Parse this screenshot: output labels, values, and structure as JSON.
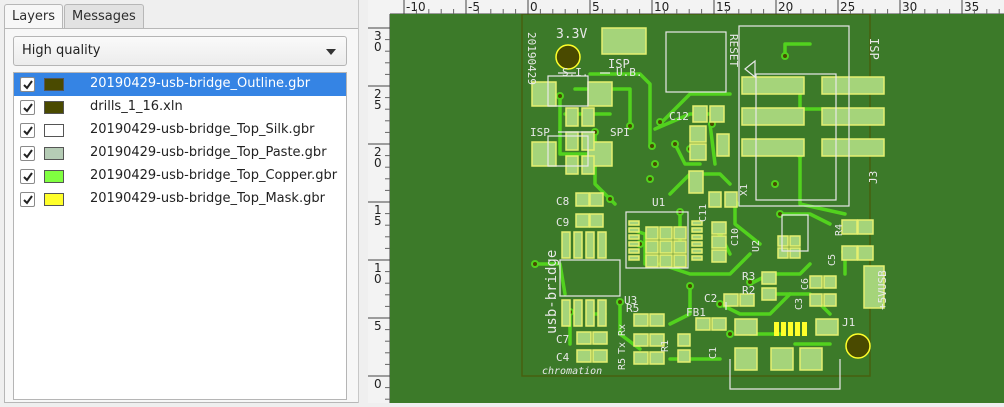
{
  "tabs": [
    {
      "label": "Layers",
      "active": true
    },
    {
      "label": "Messages",
      "active": false
    }
  ],
  "quality_select": {
    "value": "High quality"
  },
  "layers": [
    {
      "name": "20190429-usb-bridge_Outline.gbr",
      "visible": true,
      "color": "#4a4a00",
      "selected": true
    },
    {
      "name": "drills_1_16.xln",
      "visible": true,
      "color": "#4a4a00",
      "selected": false
    },
    {
      "name": "20190429-usb-bridge_Top_Silk.gbr",
      "visible": true,
      "color": "#ffffff",
      "selected": false
    },
    {
      "name": "20190429-usb-bridge_Top_Paste.gbr",
      "visible": true,
      "color": "#b5ccb5",
      "selected": false
    },
    {
      "name": "20190429-usb-bridge_Top_Copper.gbr",
      "visible": true,
      "color": "#80ff40",
      "selected": false
    },
    {
      "name": "20190429-usb-bridge_Top_Mask.gbr",
      "visible": true,
      "color": "#ffff2a",
      "selected": false
    }
  ],
  "ruler_h": [
    "-10",
    "-5",
    "0",
    "5",
    "10",
    "15",
    "20",
    "25",
    "30",
    "35"
  ],
  "ruler_v": [
    "3\n0",
    "2\n5",
    "2\n0",
    "1\n5",
    "1\n0",
    "5",
    "0"
  ],
  "silkscreen": {
    "voltage": "3.3V",
    "date": "20190429",
    "isp_top": "ISP",
    "si": "S.I.",
    "ub": "U.B.",
    "reset": "RESET",
    "isp_right": "ISP",
    "isp_left": "ISP",
    "spi": "SPI",
    "c12": "C12",
    "c8": "C8",
    "c9": "C9",
    "u1": "U1",
    "c11": "C11",
    "x1": "X1",
    "c10": "C10",
    "u2": "U2",
    "r4": "R4",
    "c5": "C5",
    "j3": "J3",
    "board_name": "usb-bridge",
    "u3": "U3",
    "r3": "R3",
    "r2": "R2",
    "c3": "C3",
    "c6": "C6",
    "c2": "C2",
    "r5": "R5",
    "fb1": "FB1",
    "c7": "C7",
    "c4": "C4",
    "r1": "R1",
    "c1": "C1",
    "j1": "J1",
    "rx": "Rx",
    "tx": "Tx",
    "r5b": "R5",
    "plus5": "+5VUSB",
    "logo": "chromation"
  }
}
